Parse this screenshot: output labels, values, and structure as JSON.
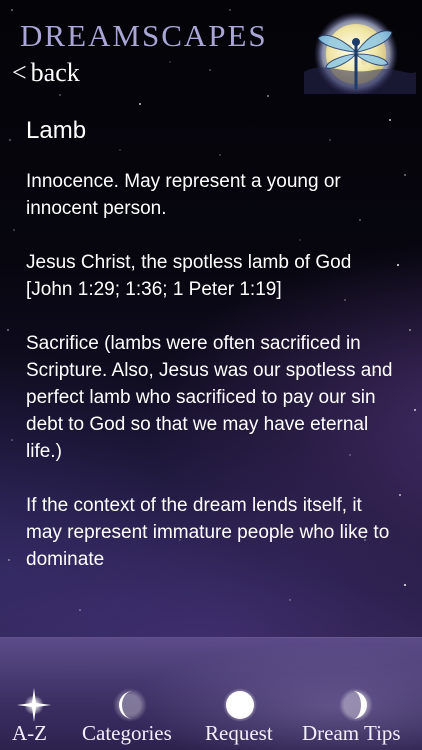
{
  "header": {
    "app_title": "DREAMSCAPES",
    "back_label": "back",
    "back_chevron": "<"
  },
  "entry": {
    "title": "Lamb",
    "paragraphs": [
      "Innocence. May represent a young or innocent person.",
      "Jesus Christ, the spotless lamb of God [John 1:29; 1:36; 1 Peter 1:19]",
      "Sacrifice (lambs were often sacrificed in Scripture. Also, Jesus was our spotless and perfect lamb who sacrificed to pay our sin debt to God so that we may have eternal life.)",
      "If the context of the dream lends itself, it may represent immature people who like to dominate"
    ]
  },
  "tabs": [
    {
      "label": "A-Z",
      "icon": "sparkle-star-icon"
    },
    {
      "label": "Categories",
      "icon": "crescent-moon-icon"
    },
    {
      "label": "Request",
      "icon": "full-moon-icon"
    },
    {
      "label": "Dream Tips",
      "icon": "half-moon-icon"
    }
  ],
  "colors": {
    "title_lavender": "#a9a6d6",
    "text": "#ffffff",
    "tab_bar": "#4a3c7a"
  }
}
